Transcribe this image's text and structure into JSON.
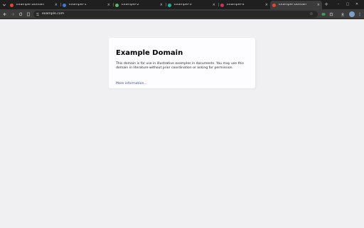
{
  "browser": {
    "tabs": [
      {
        "title": "Example Domain",
        "favicon_color": "#e5462f",
        "active": false
      },
      {
        "title": "Example-1",
        "favicon_color": "#3a7bd5",
        "active": false
      },
      {
        "title": "Example-2",
        "favicon_color": "#5cb85c",
        "active": false
      },
      {
        "title": "Example-3",
        "favicon_color": "#20b2aa",
        "active": false
      },
      {
        "title": "Example-4",
        "favicon_color": "#d0325a",
        "active": false
      },
      {
        "title": "Example Domain",
        "favicon_color": "#e5462f",
        "active": true
      }
    ],
    "tab_close_glyph": "×",
    "new_tab_glyph": "+",
    "address_bar": {
      "url": "example.com"
    },
    "window_controls": {
      "minimize": "–",
      "maximize": "▢",
      "close": "✕"
    }
  },
  "page": {
    "heading": "Example Domain",
    "paragraph": "This domain is for use in illustrative examples in documents. You may use this domain in literature without prior coordination or asking for permission.",
    "link_text": "More information..."
  },
  "colors": {
    "page_background": "#f0f0f2",
    "card_background": "#fdfdff",
    "link": "#38488f",
    "tabstrip": "#1f1f1f",
    "toolbar": "#3c3c3c"
  }
}
